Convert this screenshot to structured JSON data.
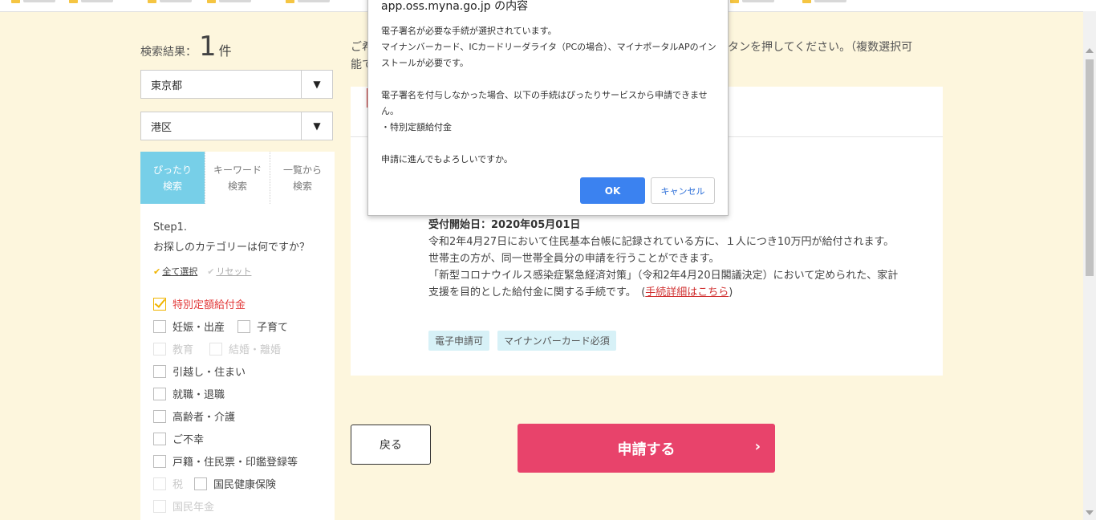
{
  "search": {
    "result_label": "検索結果：",
    "result_count": "1",
    "result_unit": "件",
    "prefecture": "東京都",
    "city": "港区",
    "dropdown_arrow": "▼"
  },
  "tabs": [
    {
      "label": "ぴったり\n検索"
    },
    {
      "label": "キーワード\n検索"
    },
    {
      "label": "一覧から\n検索"
    }
  ],
  "step": {
    "title": "Step1.",
    "question": "お探しのカテゴリーは何ですか？",
    "select_all": "全て選択",
    "reset": "リセット"
  },
  "categories": {
    "special_benefit": "特別定額給付金",
    "pregnancy": "妊娠・出産",
    "childcare": "子育て",
    "education": "教育",
    "marriage": "結婚・離婚",
    "moving": "引越し・住まい",
    "employment": "就職・退職",
    "elderly": "高齢者・介護",
    "bereavement": "ご不幸",
    "registry": "戸籍・住民票・印鑑登録等",
    "tax": "税",
    "health_insurance": "国民健康保険",
    "pension": "国民年金"
  },
  "instruction": {
    "left": "ご希\n能で",
    "right": "タンを押してください。（複数選択可"
  },
  "card": {
    "start_date": "受付開始日：2020年05月01日",
    "desc1": "令和2年4月27日において住民基本台帳に記録されている方に、１人につき10万円が給付されます。",
    "desc2": "世帯主の方が、同一世帯全員分の申請を行うことができます。",
    "desc3": "「新型コロナウイルス感染症緊急経済対策」（令和2年4月20日閣議決定）において定められた、家計支援を目的とした給付金に関する手続です。",
    "detail_link": "手続詳細はこちら",
    "tags": [
      "電子申請可",
      "マイナンバーカード必須"
    ]
  },
  "buttons": {
    "back": "戻る",
    "apply": "申請する",
    "apply_chevron": "›"
  },
  "dialog": {
    "title": "app.oss.myna.go.jp の内容",
    "message": "電子署名が必要な手続が選択されています。\nマイナンバーカード、ICカードリーダライタ（PCの場合）、マイナポータルAPのインストールが必要です。\n\n電子署名を付与しなかった場合、以下の手続はぴったりサービスから申請できません。\n・特別定額給付金\n\n申請に進んでもよろしいですか。",
    "ok": "OK",
    "cancel": "キャンセル"
  }
}
